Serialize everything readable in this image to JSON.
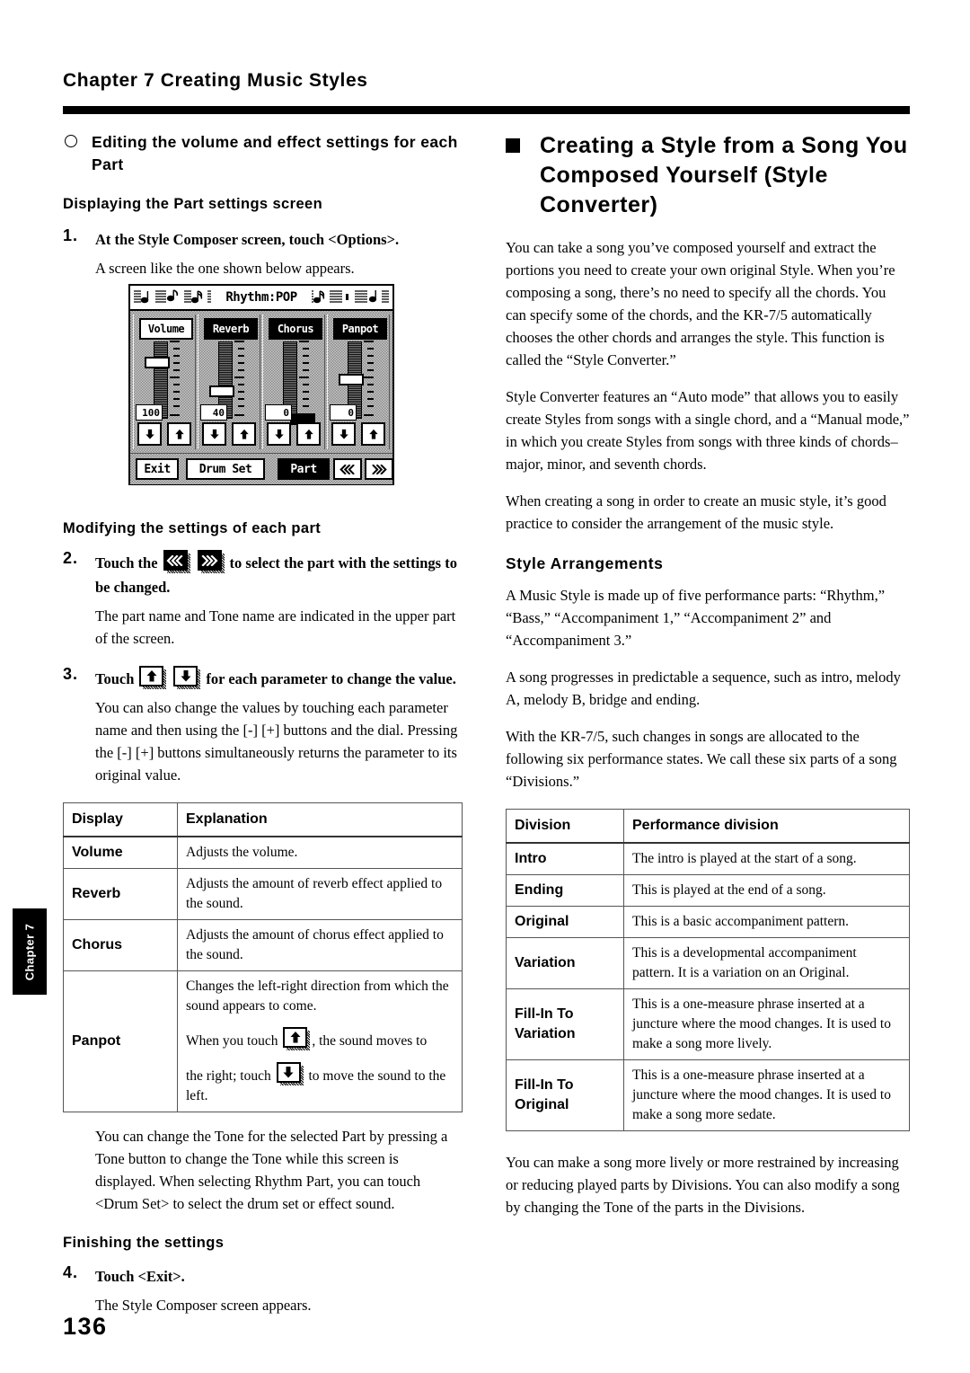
{
  "header": {
    "chapter_title": "Chapter 7  Creating Music Styles"
  },
  "side_tab": {
    "label": "Chapter 7"
  },
  "page_number": "136",
  "left_column": {
    "heading_circle": "Editing the volume and effect settings for each Part",
    "sub_heading_1": "Displaying the Part settings screen",
    "step1": {
      "num": "1.",
      "text": "At the Style Composer screen, touch <Options>.",
      "body": "A screen like the one shown below appears."
    },
    "sub_heading_2": "Modifying the settings of each part",
    "step2": {
      "num": "2.",
      "text_before": "Touch the",
      "text_after": "to select the part with the settings to be changed.",
      "body": "The part name and Tone name are indicated in the upper part of the screen."
    },
    "step3": {
      "num": "3.",
      "text_before": "Touch",
      "text_after": "for each parameter to change the value.",
      "body": "You can also change the values by touching each parameter name and then using the [-] [+] buttons and the dial. Pressing the [-] [+] buttons simultaneously returns the parameter to its original value."
    },
    "table": {
      "headers": [
        "Display",
        "Explanation"
      ],
      "rows": [
        {
          "display": "Volume",
          "explanation": "Adjusts the volume."
        },
        {
          "display": "Reverb",
          "explanation": "Adjusts the amount of reverb effect applied to the sound."
        },
        {
          "display": "Chorus",
          "explanation": "Adjusts the amount of chorus effect applied to the sound."
        },
        {
          "display": "Panpot",
          "explanation_p1": "Changes the left-right direction from which the sound appears to come.",
          "explanation_p2a": "When you touch",
          "explanation_p2b": ", the sound moves to",
          "explanation_p3a": "the right; touch",
          "explanation_p3b": "to move the sound to the left."
        }
      ]
    },
    "after_table_body": "You can change the Tone for the selected Part by pressing a Tone button to change the Tone while this screen is displayed. When selecting Rhythm Part, you can touch <Drum Set> to select the drum set or effect sound.",
    "sub_heading_3": "Finishing the settings",
    "step4": {
      "num": "4.",
      "text": "Touch <Exit>.",
      "body": "The Style Composer screen appears."
    }
  },
  "lcd_screen": {
    "title": "Rhythm:POP",
    "channels": [
      {
        "label": "Volume",
        "selected": true,
        "value": "100",
        "knob_pos_pct": 22,
        "knob_side": false
      },
      {
        "label": "Reverb",
        "selected": false,
        "value": "40",
        "knob_pos_pct": 60,
        "knob_side": false
      },
      {
        "label": "Chorus",
        "selected": false,
        "value": "0",
        "knob_pos_pct": 98,
        "knob_side": true
      },
      {
        "label": "Panpot",
        "selected": false,
        "value": "0",
        "knob_pos_pct": 50,
        "knob_side": false
      }
    ],
    "down_arrow_icon": "arrow-down-icon",
    "up_arrow_icon": "arrow-up-icon",
    "footer_buttons": [
      {
        "label": "Exit",
        "style": "white"
      },
      {
        "label": "Drum Set",
        "style": "white"
      },
      {
        "label": "Part",
        "style": "black"
      },
      {
        "label": "«‹",
        "style": "white"
      },
      {
        "label": "›»",
        "style": "white"
      }
    ]
  },
  "right_column": {
    "heading_square": "Creating a Style from a Song You Composed Yourself (Style Converter)",
    "para1": "You can take a song you’ve composed yourself and extract the portions you need to create your own original Style. When you’re composing a song, there’s no need to specify all the chords. You can specify some of the chords, and the KR-7/5 automatically chooses the other chords and arranges the style. This function is called the “Style Converter.”",
    "para2": "Style Converter features an “Auto mode” that allows you to easily create Styles from songs with a single chord, and a “Manual mode,” in which you create Styles from songs with three kinds of chords–major, minor, and seventh chords.",
    "para3": "When creating a song in order to create an music style, it’s good practice to consider the arrangement of the music style.",
    "sub_heading": "Style Arrangements",
    "para4": "A Music Style is made up of five performance parts: “Rhythm,” “Bass,” “Accompaniment 1,” “Accompaniment 2” and “Accompaniment 3.”",
    "para5": "A song progresses in predictable a sequence, such as intro, melody A, melody B, bridge and ending.",
    "para6": "With the KR-7/5, such changes in songs are allocated to the following six performance states. We call these six parts of a song “Divisions.”",
    "table": {
      "headers": [
        "Division",
        "Performance division"
      ],
      "rows": [
        {
          "division": "Intro",
          "description": "The intro is played at the start of a song."
        },
        {
          "division": "Ending",
          "description": "This is played at the end of a song."
        },
        {
          "division": "Original",
          "description": "This is a basic accompaniment pattern."
        },
        {
          "division": "Variation",
          "description": "This is a developmental accompaniment pattern. It is a variation on an Original."
        },
        {
          "division": "Fill-In To\nVariation",
          "description": "This is a one-measure phrase inserted at a juncture where the mood changes. It is used to make a song more lively."
        },
        {
          "division": "Fill-In To\nOriginal",
          "description": "This is a one-measure phrase inserted at a juncture where the mood changes. It is used to make a song more sedate."
        }
      ]
    },
    "para7": "You can make a song more lively or more restrained by increasing or reducing played parts by Divisions. You can also modify a song by changing the Tone of the parts in the Divisions."
  }
}
